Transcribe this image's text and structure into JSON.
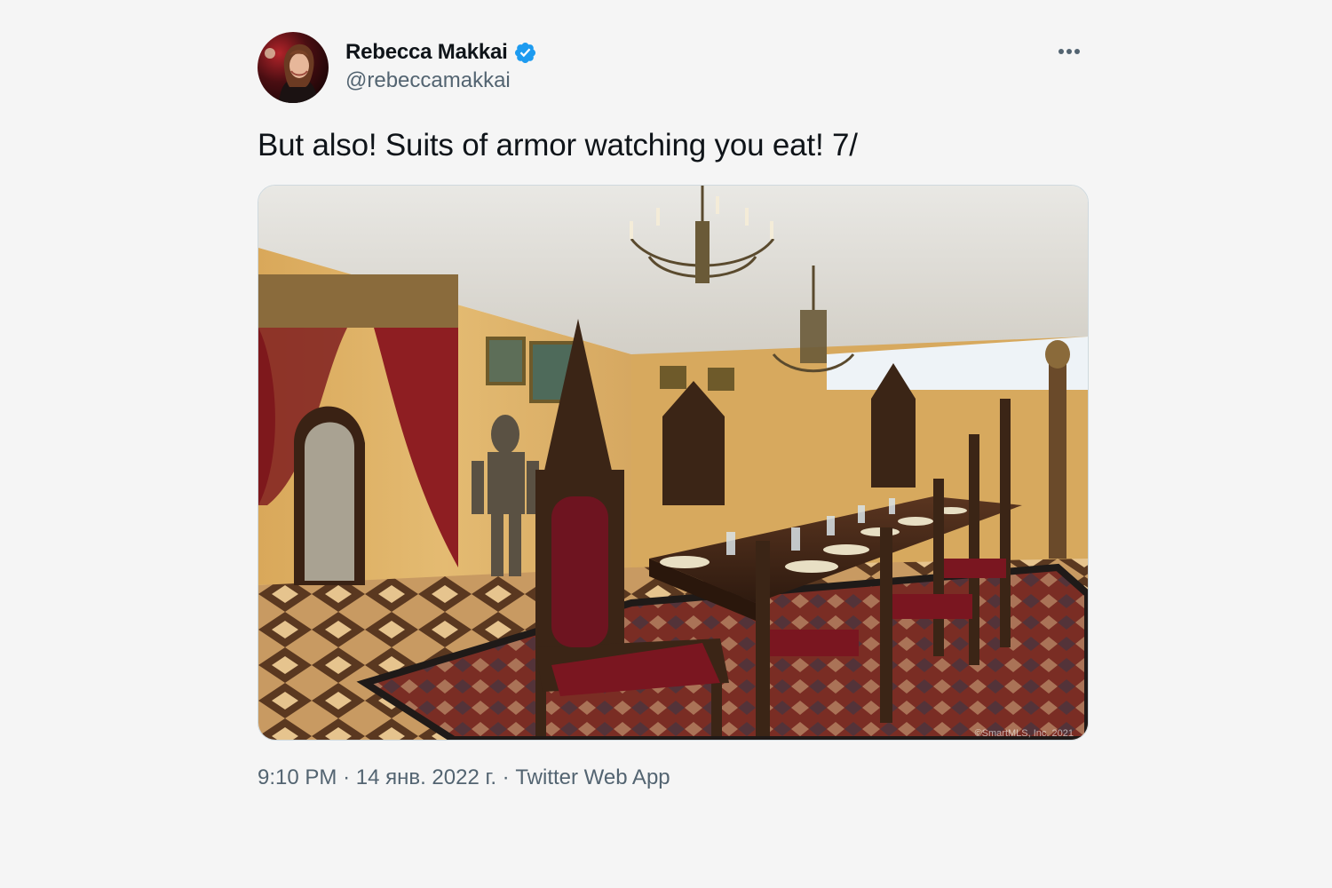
{
  "author": {
    "display_name": "Rebecca Makkai",
    "handle": "@rebeccamakkai",
    "verified": true
  },
  "tweet": {
    "text": "But also! Suits of armor watching you eat! 7/"
  },
  "media": {
    "watermark": "©SmartMLS, Inc. 2021"
  },
  "meta": {
    "time": "9:10 PM",
    "separator": "·",
    "date": "14 янв. 2022 г.",
    "source": "Twitter Web App"
  },
  "icons": {
    "verified": "verified-badge-icon",
    "more": "more-options-icon"
  },
  "colors": {
    "background": "#f5f5f5",
    "text_primary": "#0f1419",
    "text_secondary": "#536471",
    "verified_blue": "#1d9bf0"
  }
}
